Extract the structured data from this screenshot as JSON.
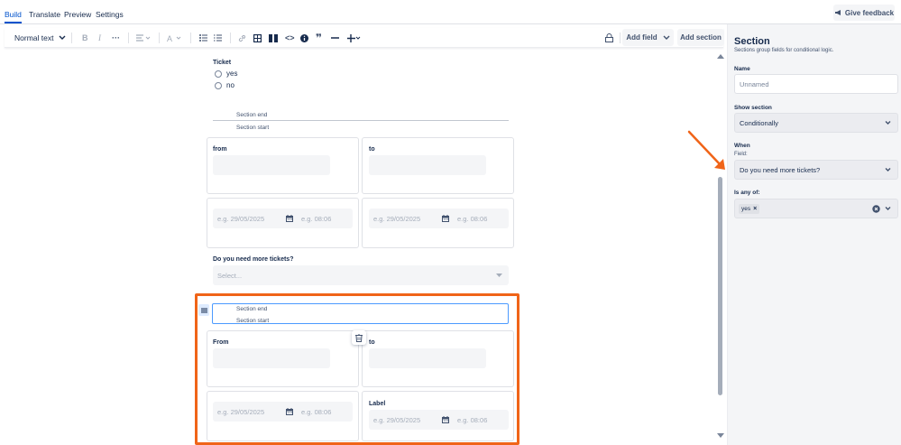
{
  "tabs": [
    "Build",
    "Translate",
    "Preview",
    "Settings"
  ],
  "feedback_label": "Give feedback",
  "toolbar": {
    "text_style": "Normal text",
    "add_field": "Add field",
    "add_section": "Add section"
  },
  "form": {
    "ticket_label": "Ticket",
    "ticket_options": [
      "yes",
      "no"
    ],
    "section_end": "Section end",
    "section_start": "Section start",
    "from_label_1": "from",
    "to_label_1": "to",
    "date_placeholder": "e.g. 29/05/2025",
    "time_placeholder": "e.g. 08:06",
    "more_tickets_label": "Do you need more tickets?",
    "select_placeholder": "Select...",
    "section_end_2": "Section end",
    "section_start_2": "Section start",
    "from_label_2": "From",
    "to_label_2": "to",
    "label_label": "Label"
  },
  "panel": {
    "title": "Section",
    "subtitle": "Sections group fields for conditional logic.",
    "name_label": "Name",
    "name_placeholder": "Unnamed",
    "show_section_label": "Show section",
    "show_section_value": "Conditionally",
    "when_label": "When",
    "field_label": "Field:",
    "field_value": "Do you need more tickets?",
    "is_any_of_label": "Is any of:",
    "tag_value": "yes"
  },
  "colors": {
    "accent": "#0052cc",
    "highlight": "#f06418"
  }
}
